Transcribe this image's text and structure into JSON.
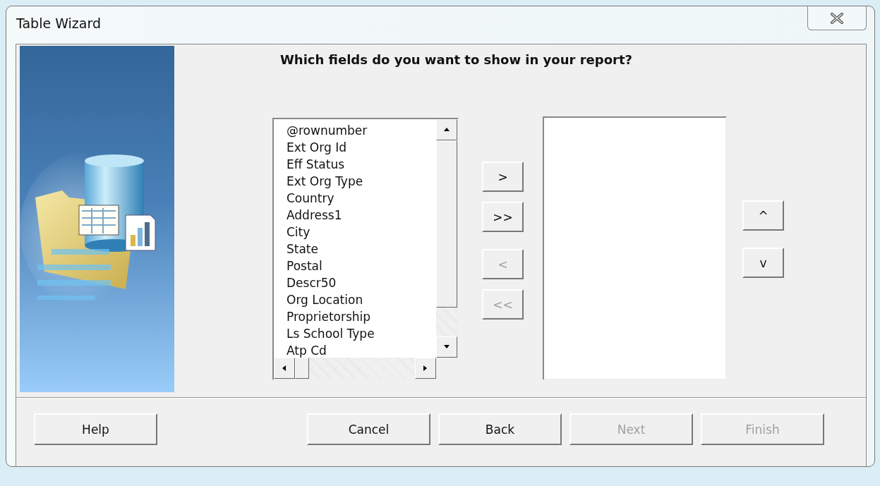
{
  "window": {
    "title": "Table Wizard"
  },
  "heading": "Which fields do you want to show in your report?",
  "available_fields": [
    {
      "label": "@rownumber",
      "selected": false
    },
    {
      "label": "Ext Org Id",
      "selected": false
    },
    {
      "label": "Eff Status",
      "selected": false
    },
    {
      "label": "Ext Org Type",
      "selected": false
    },
    {
      "label": "Country",
      "selected": false
    },
    {
      "label": "Address1",
      "selected": false
    },
    {
      "label": "City",
      "selected": false
    },
    {
      "label": "State",
      "selected": false
    },
    {
      "label": "Postal",
      "selected": false
    },
    {
      "label": "Descr50",
      "selected": false
    },
    {
      "label": "Org Location",
      "selected": false
    },
    {
      "label": "Proprietorship",
      "selected": false
    },
    {
      "label": "Ls School Type",
      "selected": false
    },
    {
      "label": "Atp Cd",
      "selected": false
    }
  ],
  "transfer_buttons": [
    {
      "label": ">",
      "disabled": false
    },
    {
      "label": ">>",
      "disabled": false
    },
    {
      "label": "<",
      "disabled": true
    },
    {
      "label": "<<",
      "disabled": true
    }
  ],
  "order_buttons": [
    {
      "label": "^",
      "disabled": false
    },
    {
      "label": "v",
      "disabled": false
    }
  ],
  "footer_buttons": [
    {
      "label": "Help",
      "disabled": false
    },
    {
      "label": "Cancel",
      "disabled": false
    },
    {
      "label": "Back",
      "disabled": false
    },
    {
      "label": "Next",
      "disabled": true
    },
    {
      "label": "Finish",
      "disabled": true
    }
  ]
}
